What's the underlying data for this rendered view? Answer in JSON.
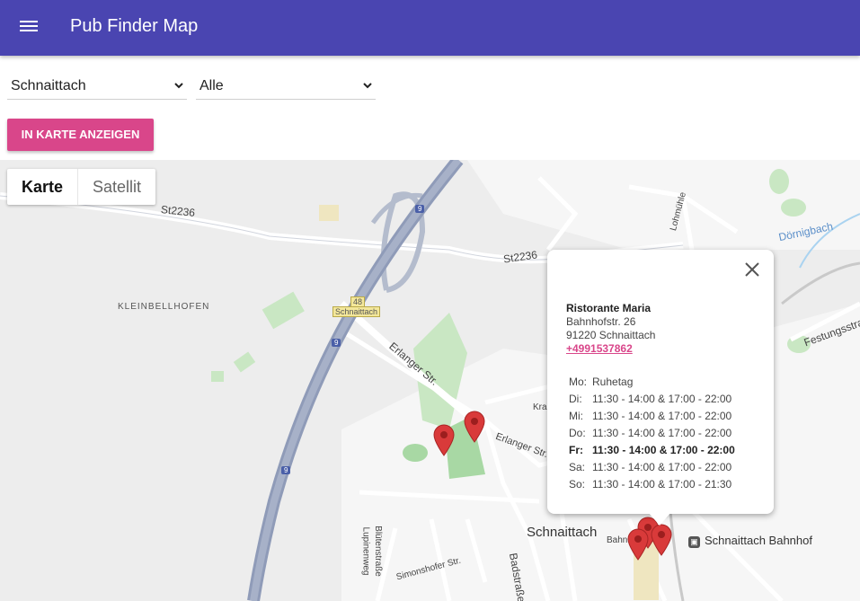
{
  "app": {
    "title": "Pub Finder Map"
  },
  "filters": {
    "city": "Schnaittach",
    "type": "Alle"
  },
  "actions": {
    "show_label": "IN KARTE ANZEIGEN"
  },
  "map": {
    "types": [
      "Karte",
      "Satellit"
    ],
    "labels": {
      "st2236_left": "St2236",
      "st2236_right": "St2236",
      "kleinbellhofen": "KLEINBELLHOFEN",
      "erlanger_1": "Erlanger Str.",
      "erlanger_2": "Erlanger Str.",
      "schnaittach_sign": "Schnaittach",
      "exit_48": "48",
      "a9_1": "9",
      "a9_2": "9",
      "a9_3": "9",
      "town": "Schnaittach",
      "bahnhof": "Schnaittach Bahnhof",
      "doernigbach": "Dörnigbach",
      "festungsstr": "Festungsstra",
      "lohmuehle": "Lohmühle",
      "badstrasse": "Badstraße",
      "lupinenweg": "Lupinenweg",
      "bluetenstrasse": "Blütenstraße",
      "simonshofer": "Simonshofer Str.",
      "kra": "Kra",
      "bahnhofstr_part": "Bahnho"
    }
  },
  "infowindow": {
    "name": "Ristorante Maria",
    "street": "Bahnhofstr. 26",
    "city": "91220 Schnaittach",
    "phone": "+4991537862",
    "hours": [
      {
        "day": "Mo:",
        "time": "Ruhetag"
      },
      {
        "day": "Di:",
        "time": "11:30 - 14:00 & 17:00 - 22:00"
      },
      {
        "day": "Mi:",
        "time": "11:30 - 14:00 & 17:00 - 22:00"
      },
      {
        "day": "Do:",
        "time": "11:30 - 14:00 & 17:00 - 22:00"
      },
      {
        "day": "Fr:",
        "time": "11:30 - 14:00 & 17:00 - 22:00"
      },
      {
        "day": "Sa:",
        "time": "11:30 - 14:00 & 17:00 - 22:00"
      },
      {
        "day": "So:",
        "time": "11:30 - 14:00 & 17:00 - 21:30"
      }
    ],
    "today_index": 4
  },
  "colors": {
    "appbar": "#4a45b1",
    "accent": "#d9468a",
    "pin": "#d93a3a",
    "highway": "#8f9bb8"
  }
}
